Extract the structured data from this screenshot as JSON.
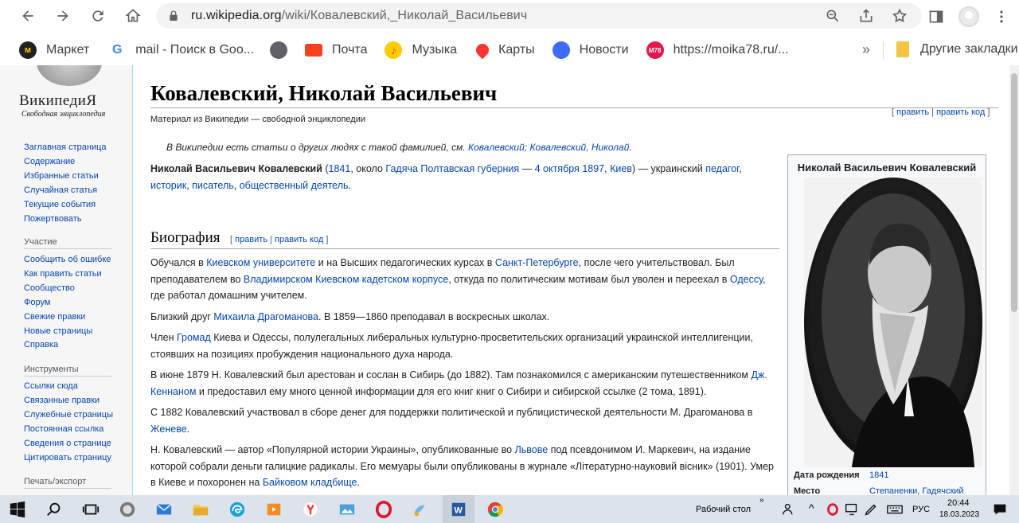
{
  "browser": {
    "url_host": "ru.wikipedia.org",
    "url_path": "/wiki/Ковалевский,_Николай_Васильевич"
  },
  "bookmarks": [
    {
      "label": "Маркет",
      "icon": "yandex-market-icon",
      "color": "#fc3f1d",
      "glyph": "M"
    },
    {
      "label": "mail - Поиск в Goo...",
      "icon": "google-icon",
      "color": "#4285f4",
      "glyph": "G"
    },
    {
      "label": "",
      "icon": "globe-icon",
      "color": "#5f6368",
      "glyph": ""
    },
    {
      "label": "Почта",
      "icon": "mail-icon",
      "color": "#fc3f1d",
      "glyph": ""
    },
    {
      "label": "Музыка",
      "icon": "music-icon",
      "color": "#ffcc00",
      "glyph": "♪"
    },
    {
      "label": "Карты",
      "icon": "map-pin-icon",
      "color": "#f33",
      "glyph": ""
    },
    {
      "label": "Новости",
      "icon": "news-icon",
      "color": "#3d6cf6",
      "glyph": ""
    },
    {
      "label": "https://moika78.ru/...",
      "icon": "moika78-icon",
      "color": "#e5134f",
      "glyph": "M78"
    }
  ],
  "bookmarks_more": "»",
  "bookmarks_other": "Другие закладки",
  "sidebar": {
    "logo_title": "ВикипедиЯ",
    "logo_subtitle": "Свободная энциклопедия",
    "main_links": [
      "Заглавная страница",
      "Содержание",
      "Избранные статьи",
      "Случайная статья",
      "Текущие события",
      "Пожертвовать"
    ],
    "participation_heading": "Участие",
    "participation_links": [
      "Сообщить об ошибке",
      "Как править статьи",
      "Сообщество",
      "Форум",
      "Свежие правки",
      "Новые страницы",
      "Справка"
    ],
    "tools_heading": "Инструменты",
    "tools_links": [
      "Ссылки сюда",
      "Связанные правки",
      "Служебные страницы",
      "Постоянная ссылка",
      "Сведения о странице",
      "Цитировать страницу"
    ],
    "print_heading": "Печать/экспорт"
  },
  "article": {
    "title": "Ковалевский, Николай Васильевич",
    "tagline": "Материал из Википедии — свободной энциклопедии",
    "edit": "править",
    "edit_code": "править код",
    "hatnote_text": "В Википедии есть статьи о других людях с такой фамилией, см.",
    "hatnote_link1": "Ковалевский",
    "hatnote_link2": "Ковалевский, Николай",
    "section_biography": "Биография"
  },
  "infobox": {
    "title": "Николай Васильевич Ковалевский",
    "birth_label": "Дата рождения",
    "birth_value": "1841",
    "place_label": "Место",
    "place_value": "Степаненки, Гадячский"
  },
  "taskbar": {
    "desktop_label": "Рабочий стол",
    "lang": "РУС",
    "time": "20:44",
    "date": "18.03.2023"
  }
}
